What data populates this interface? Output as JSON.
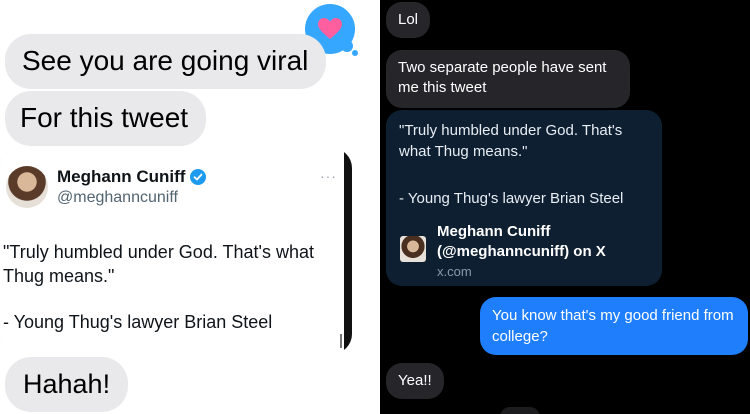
{
  "left_thread": {
    "reaction_icon": "heart-icon",
    "reaction_color": "#35a7ff",
    "messages": [
      {
        "text": "See you are going viral"
      },
      {
        "text": "For this tweet"
      },
      {
        "text": "Hahah!"
      }
    ],
    "tweet": {
      "author_name": "Meghann Cuniff",
      "author_handle": "@meghanncuniff",
      "more_icon": "···",
      "text": "\"Truly humbled under God. That's what Thug means.\"",
      "attribution": "- Young Thug's lawyer Brian Steel",
      "verified_color": "#1d9bf0"
    }
  },
  "right_thread": {
    "messages_received": [
      {
        "text": "Lol"
      },
      {
        "text": "Two separate people have sent me this tweet"
      },
      {
        "text": "Yea!!"
      }
    ],
    "link_preview": {
      "quote": "\"Truly humbled under God. That's what Thug means.\"",
      "attribution": "- Young Thug's lawyer Brian Steel",
      "title": "Meghann Cuniff (@meghanncuniff) on X",
      "domain": "x.com"
    },
    "sent_message": {
      "text": "You know that's my good friend from college?",
      "color": "#1f7efb"
    }
  }
}
